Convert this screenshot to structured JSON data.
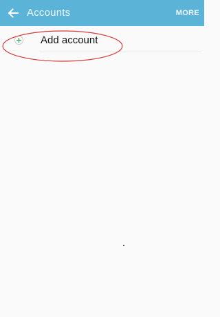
{
  "app_bar": {
    "title": "Accounts",
    "back_icon": "arrow-left-icon",
    "more_label": "MORE",
    "color": "#5bb4d8"
  },
  "accounts_list": {
    "add_account": {
      "label": "Add account",
      "icon": "plus-circle-icon",
      "icon_color": "#3aa657"
    }
  },
  "annotation": {
    "shape": "ellipse",
    "color": "#d23b3b"
  }
}
